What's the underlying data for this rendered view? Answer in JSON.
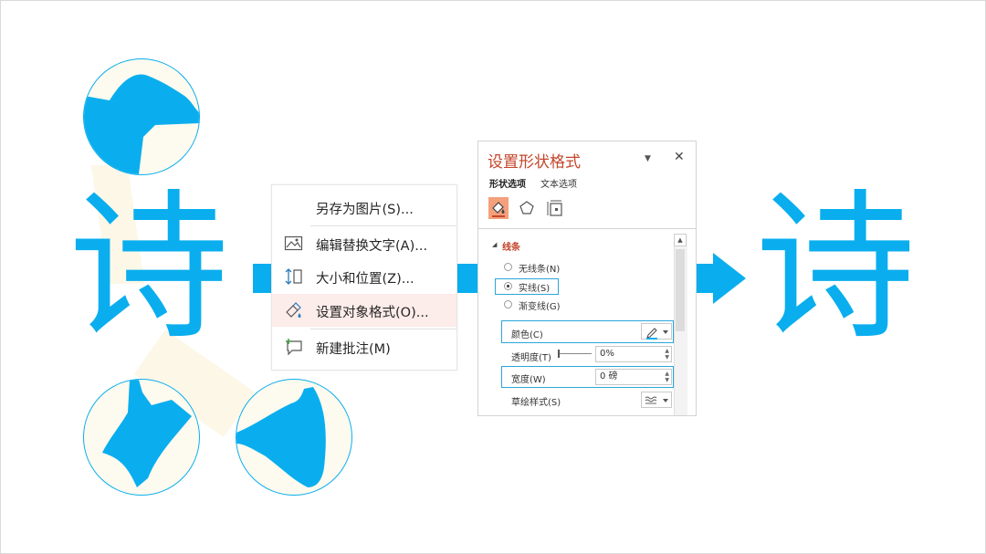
{
  "slide": {
    "source_char": "诗",
    "result_char": "诗"
  },
  "context_menu": {
    "items": [
      {
        "label": "另存为图片(S)...",
        "icon": "none"
      },
      {
        "label": "编辑替换文字(A)...",
        "icon": "image-alt-text-icon"
      },
      {
        "label": "大小和位置(Z)...",
        "icon": "size-position-icon"
      },
      {
        "label": "设置对象格式(O)...",
        "icon": "format-object-icon",
        "highlighted": true
      },
      {
        "label": "新建批注(M)",
        "icon": "new-comment-icon"
      }
    ]
  },
  "format_pane": {
    "title": "设置形状格式",
    "dropdown_glyph": "▼",
    "close_glyph": "✕",
    "tabs": [
      "形状选项",
      "文本选项"
    ],
    "icon_tabs": [
      "fill-line-icon",
      "effects-pentagon-icon",
      "size-properties-icon"
    ],
    "section": {
      "title": "线条",
      "toggle_glyph": "◢"
    },
    "line_options": [
      {
        "label": "无线条(N)",
        "selected": false
      },
      {
        "label": "实线(S)",
        "selected": true
      },
      {
        "label": "渐变线(G)",
        "selected": false
      }
    ],
    "props": {
      "color_label": "颜色(C)",
      "transparency_label": "透明度(T)",
      "transparency_value": "0%",
      "width_label": "宽度(W)",
      "width_value": "0 磅",
      "sketch_label": "草绘样式(S)"
    },
    "scroll_up_glyph": "▲"
  },
  "colors": {
    "accent_blue": "#0aaeee",
    "pane_title": "#c4462b",
    "highlight_box": "#2ba6d9",
    "beam": "#fdf6e3"
  }
}
